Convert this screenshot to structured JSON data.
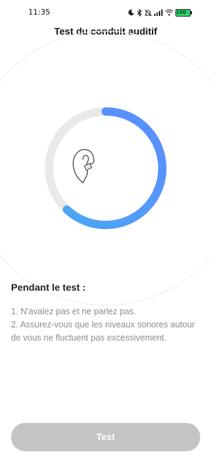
{
  "status_bar": {
    "time": "11:35",
    "battery": "100",
    "icons": [
      "moon-icon",
      "bluetooth-icon",
      "mute-icon",
      "signal-icon",
      "wifi-icon",
      "battery-icon"
    ]
  },
  "header": {
    "title": "Test du conduit auditif"
  },
  "gauge": {
    "progress": 0.62,
    "track_color": "#e9e9e9",
    "gradient_colors": [
      "#4aa8f4",
      "#5b8cff"
    ],
    "icon": "ear-icon"
  },
  "instructions": {
    "heading": "Pendant le test :",
    "items": [
      "1. N'avalez pas et ne parlez pas.",
      "2. Assurez-vous que les niveaux sonores autour de vous ne fluctuent pas excessivement."
    ]
  },
  "actions": {
    "test_label": "Test",
    "button_color": "#c4c4c4"
  }
}
